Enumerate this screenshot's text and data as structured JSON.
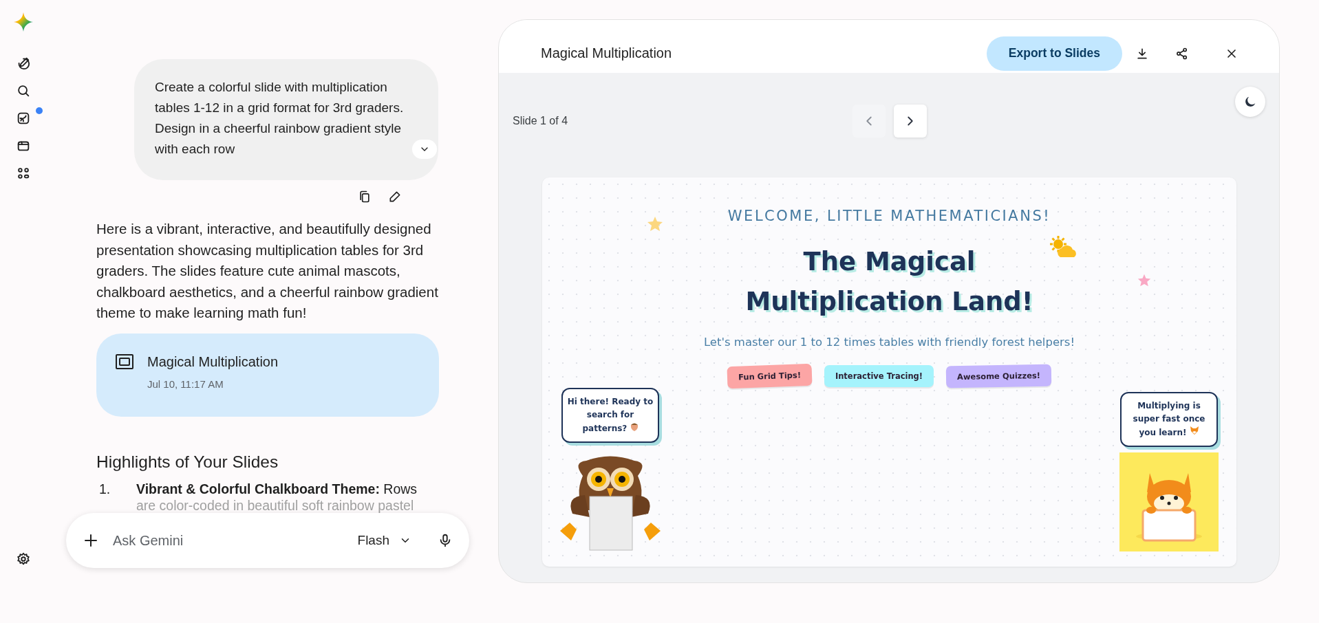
{
  "sidebar": {
    "items": [
      {
        "kind": "new-chat",
        "notification": false
      },
      {
        "kind": "search",
        "notification": false
      },
      {
        "kind": "gallery",
        "notification": true
      },
      {
        "kind": "canvas",
        "notification": false
      },
      {
        "kind": "apps",
        "notification": false
      }
    ]
  },
  "chat": {
    "prompt": "Create a colorful slide with multiplication tables 1-12 in a grid format for 3rd graders. Design in a cheerful rainbow gradient style with each row",
    "response": "Here is a vibrant, interactive, and beautifully designed presentation showcasing multiplication tables for 3rd graders. The slides feature cute animal mascots, chalkboard aesthetics, and a cheerful rainbow gradient theme to make learning math fun!",
    "artifact": {
      "title": "Magical Multiplication",
      "date": "Jul 10, 11:17 AM"
    },
    "heading": "Highlights of Your Slides",
    "list": [
      {
        "marker": "1.",
        "text": "**Vibrant & Colorful Chalkboard Theme:** Rows",
        "faded_text": "are color-coded in beautiful soft rainbow pastel"
      }
    ],
    "input": {
      "placeholder": "Ask Gemini",
      "model": "Flash"
    }
  },
  "canvas": {
    "title": "Magical Multiplication",
    "export_button": "Export to Slides",
    "slide_counter": "Slide 1 of 4",
    "prev": {
      "disabled": true
    },
    "next": {
      "disabled": false
    },
    "slide": {
      "eyebrow": "WELCOME, LITTLE MATHEMATICIANS!",
      "title": "The Magical Multiplication Land!",
      "subtitle": "Let's master our 1 to 12 times tables with friendly forest helpers!",
      "tags": [
        {
          "label": "Fun Grid Tips!",
          "color": "#fca5a5"
        },
        {
          "label": "Interactive Tracing!",
          "color": "#a5f3fc"
        },
        {
          "label": "Awesome Quizzes!",
          "color": "#c4b5fd"
        }
      ],
      "mascots": [
        {
          "kind": "owl",
          "speech": "Hi there! Ready to search for patterns?"
        },
        {
          "kind": "fox",
          "speech": "Multiplying is super fast once you learn!"
        }
      ]
    }
  }
}
